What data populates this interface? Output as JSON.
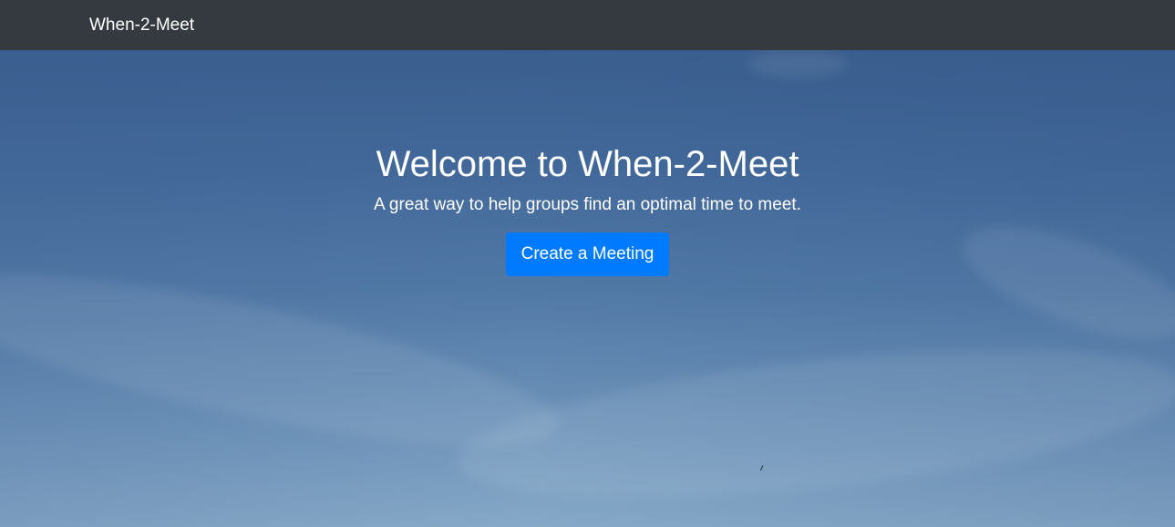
{
  "navbar": {
    "brand": "When-2-Meet"
  },
  "hero": {
    "title": "Welcome to When-2-Meet",
    "subtitle": "A great way to help groups find an optimal time to meet.",
    "cta_label": "Create a Meeting"
  },
  "colors": {
    "navbar_bg": "#343a40",
    "primary_button": "#007bff",
    "text": "#ffffff"
  }
}
